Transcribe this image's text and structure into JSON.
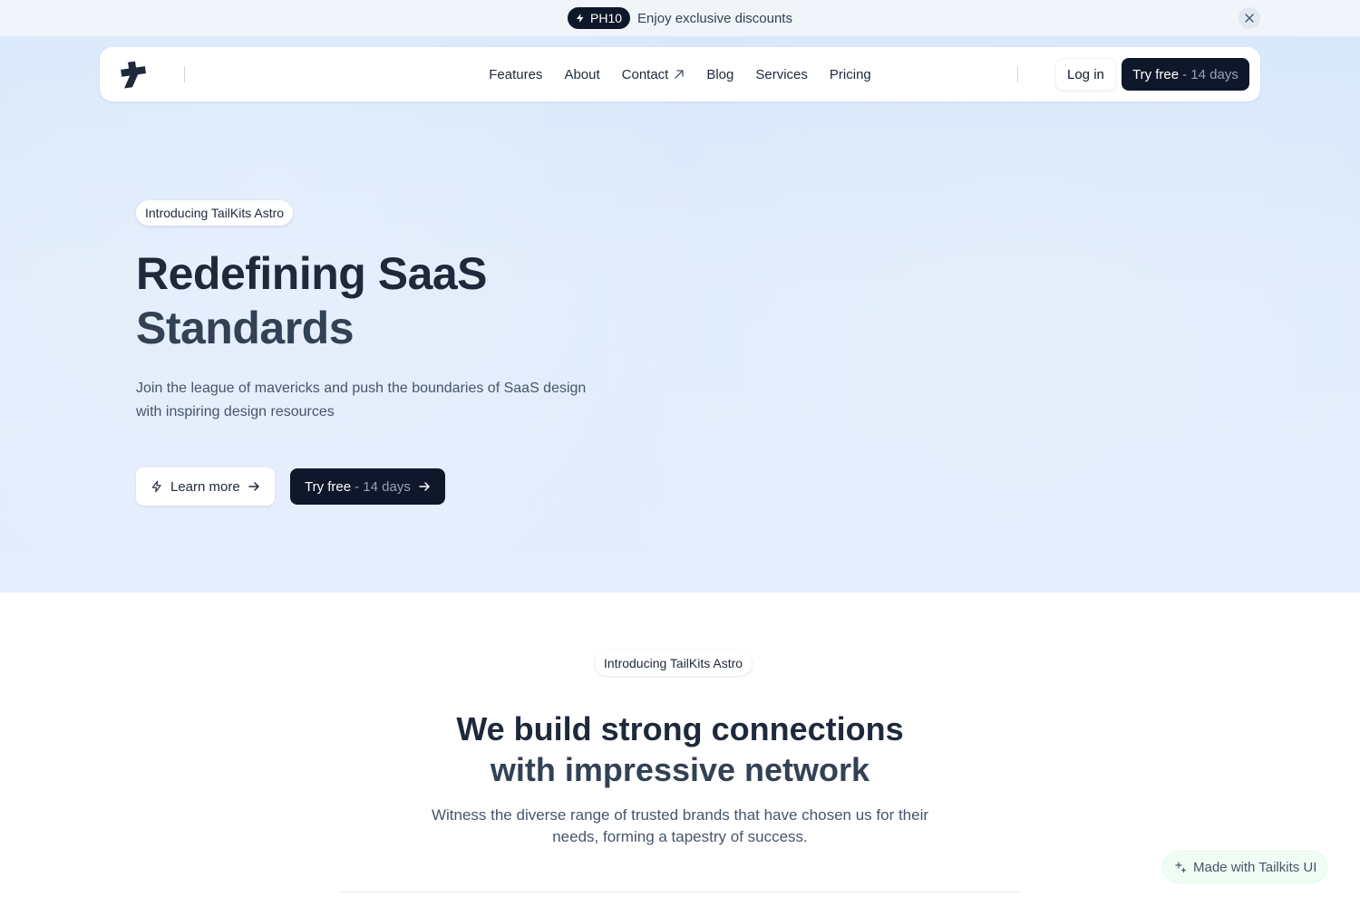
{
  "announcement": {
    "badge": "PH10",
    "text": "Enjoy exclusive discounts",
    "icons": {
      "badge": "lightning-icon",
      "close": "close-icon"
    }
  },
  "navbar": {
    "logo": "tailkits-logo",
    "links": [
      {
        "label": "Features"
      },
      {
        "label": "About"
      },
      {
        "label": "Contact",
        "icon": "external-arrow-icon"
      },
      {
        "label": "Blog"
      },
      {
        "label": "Services"
      },
      {
        "label": "Pricing"
      }
    ],
    "login_label": "Log in",
    "try_label": "Try free",
    "try_suffix": "- 14 days"
  },
  "hero": {
    "pill": "Introducing TailKits Astro",
    "title_line1": "Redefining SaaS",
    "title_line2": "Standards",
    "subtitle": "Join the league of mavericks and push the boundaries of SaaS design with inspiring design resources",
    "learn_label": "Learn more",
    "try_label": "Try free",
    "try_suffix": "- 14 days"
  },
  "section": {
    "pill": "Introducing TailKits Astro",
    "title_line1": "We build strong connections",
    "title_line2": "with impressive network",
    "subtitle": "Witness the diverse range of trusted brands that have chosen us for their needs, forming a tapestry of success."
  },
  "made_with": {
    "label": "Made with Tailkits UI",
    "icon": "sparkle-icon"
  },
  "colors": {
    "primary": "#0f172a",
    "hero_background": "#e1ecfb",
    "text": "#1e293b",
    "muted": "#94a3b8"
  }
}
